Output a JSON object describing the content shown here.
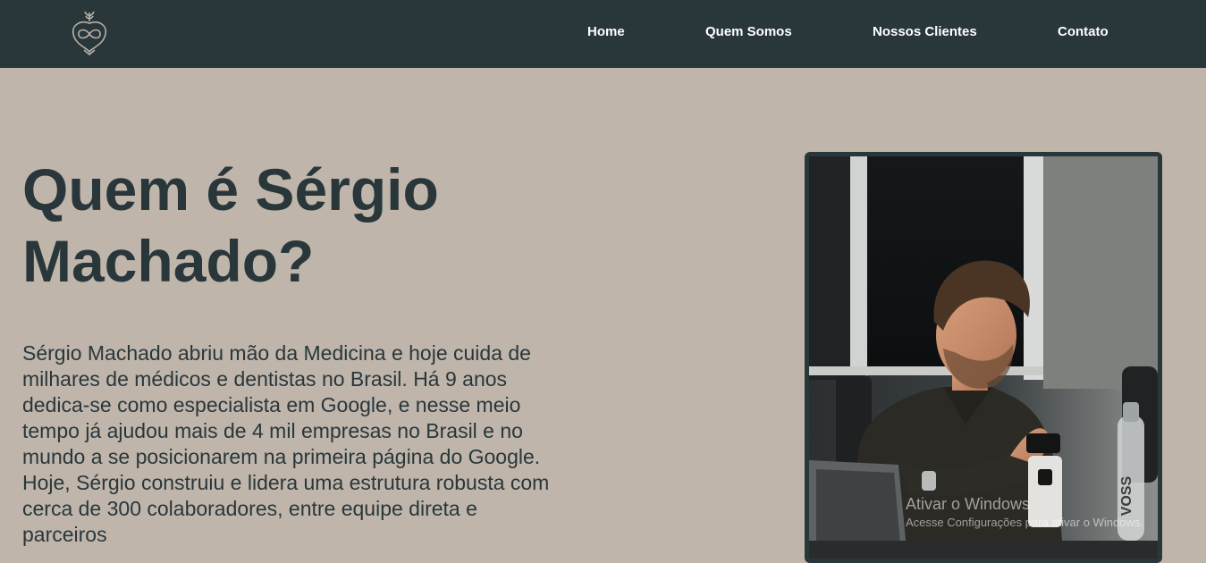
{
  "nav": {
    "items": [
      {
        "label": "Home"
      },
      {
        "label": "Quem Somos"
      },
      {
        "label": "Nossos Clientes"
      },
      {
        "label": "Contato"
      }
    ]
  },
  "hero": {
    "title": "Quem é Sérgio Machado?",
    "paragraph": "Sérgio Machado abriu mão da Medicina e hoje cuida de milhares de médicos e dentistas no Brasil. Há 9 anos dedica-se como especialista em Google, e nesse meio tempo já ajudou mais de 4 mil empresas no Brasil e no mundo a se posicionarem na primeira página do Google. Hoje, Sérgio construiu e lidera uma estrutura robusta com cerca de 300 colaboradores, entre equipe direta e parceiros"
  },
  "photo": {
    "bottle_text": "VOSS"
  },
  "watermark": {
    "title": "Ativar o Windows",
    "subtitle": "Acesse Configurações para ativar o Windows."
  },
  "colors": {
    "navbar_bg": "#29373b",
    "page_bg": "#bfb5ab",
    "text": "#29373b",
    "nav_text": "#ffffff"
  }
}
